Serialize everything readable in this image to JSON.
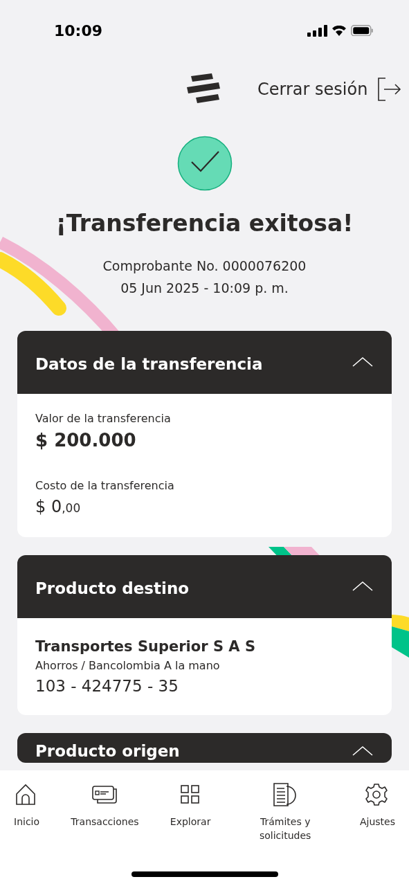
{
  "status_bar": {
    "time": "10:09"
  },
  "header": {
    "logout": "Cerrar sesión"
  },
  "result": {
    "title": "¡Transferencia exitosa!",
    "receipt": "Comprobante No. 0000076200",
    "date": "05 Jun 2025 - 10:09 p. m."
  },
  "sections": [
    {
      "title": "Datos de la transferencia",
      "expanded": true,
      "fields": [
        {
          "kind": "amount",
          "label": "Valor de la transferencia",
          "value": "$ 200.000"
        },
        {
          "kind": "cost",
          "label": "Costo de la transferencia",
          "value": "$ 0$_{,00}$"
        }
      ]
    },
    {
      "title": "Producto destino",
      "expanded": true,
      "fields": [
        {
          "kind": "name",
          "value": "Transportes Superior S A S"
        },
        {
          "kind": "type",
          "value": "Ahorros / Bancolombia A la mano"
        },
        {
          "kind": "account",
          "value": "103 - 424775 - 35"
        }
      ]
    },
    {
      "title": "Producto origen",
      "expanded": true
    }
  ],
  "nav": [
    {
      "kind": "home",
      "label": "Inicio"
    },
    {
      "kind": "cards",
      "label": "Transacciones"
    },
    {
      "kind": "grid",
      "label": "Explorar"
    },
    {
      "kind": "docs",
      "label": "Trámites y solicitudes"
    },
    {
      "kind": "gear",
      "label": "Ajustes"
    }
  ]
}
